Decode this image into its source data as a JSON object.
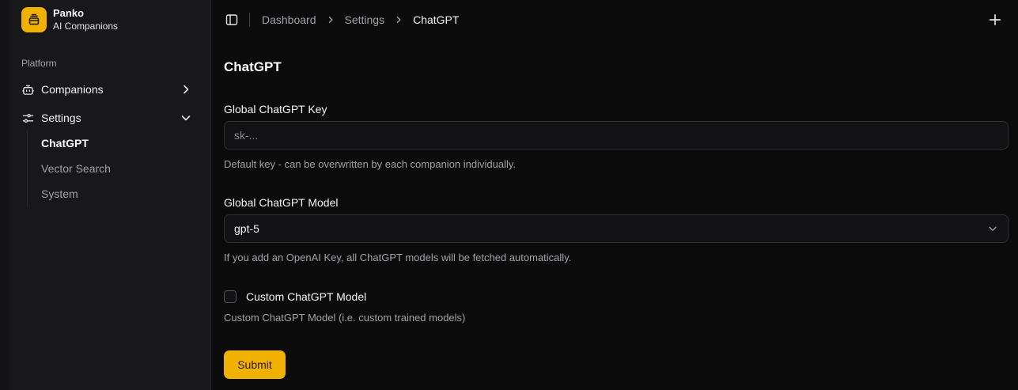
{
  "brand": {
    "name": "Panko",
    "subtitle": "AI Companions"
  },
  "sidebar": {
    "group_label": "Platform",
    "items": [
      {
        "label": "Companions",
        "icon": "bot-icon",
        "expanded": false
      },
      {
        "label": "Settings",
        "icon": "sliders-icon",
        "expanded": true
      }
    ],
    "settings_subitems": [
      {
        "label": "ChatGPT",
        "active": true
      },
      {
        "label": "Vector Search",
        "active": false
      },
      {
        "label": "System",
        "active": false
      }
    ]
  },
  "breadcrumb": [
    "Dashboard",
    "Settings",
    "ChatGPT"
  ],
  "page": {
    "title": "ChatGPT",
    "key_field": {
      "label": "Global ChatGPT Key",
      "value": "",
      "placeholder": "sk-...",
      "help": "Default key - can be overwritten by each companion individually."
    },
    "model_field": {
      "label": "Global ChatGPT Model",
      "value": "gpt-5",
      "help": "If you add an OpenAI Key, all ChatGPT models will be fetched automatically."
    },
    "custom_model": {
      "label": "Custom ChatGPT Model",
      "checked": false,
      "help": "Custom ChatGPT Model (i.e. custom trained models)"
    },
    "submit_label": "Submit"
  },
  "colors": {
    "accent": "#f0b100",
    "background": "#0b0b0c",
    "sidebar": "#18181b"
  }
}
